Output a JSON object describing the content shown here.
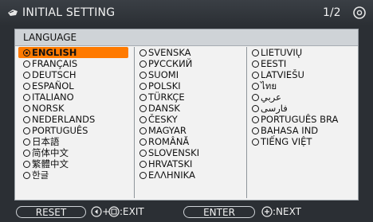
{
  "title_bar": {
    "title": "INITIAL SETTING",
    "page": "1/2"
  },
  "panel": {
    "title": "LANGUAGE",
    "columns": [
      [
        "ENGLISH",
        "FRANÇAIS",
        "DEUTSCH",
        "ESPAÑOL",
        "ITALIANO",
        "NORSK",
        "NEDERLANDS",
        "PORTUGUÊS",
        "日本語",
        "简体中文",
        "繁體中文",
        "한글"
      ],
      [
        "SVENSKA",
        "РУССКИЙ",
        "SUOMI",
        "POLSKI",
        "TÜRKÇE",
        "DANSK",
        "ČESKY",
        "MAGYAR",
        "ROMÂNĂ",
        "SLOVENSKI",
        "HRVATSKI",
        "ΕΛΛΗΝΙΚΑ"
      ],
      [
        "LIETUVIŲ",
        "EESTI",
        "LATVIEŠU",
        "ไทย",
        "عربي",
        "فارسی",
        "PORTUGUÊS BRA",
        "BAHASA IND",
        "TIẾNG VIỆT"
      ]
    ],
    "selected": "ENGLISH"
  },
  "bottom_bar": {
    "reset_label": "RESET",
    "exit_hint": "+",
    "exit_label": ":EXIT",
    "enter_label": "ENTER",
    "next_label": ":NEXT"
  },
  "colors": {
    "selection": "#ff7a00",
    "panel_bg": "#f2f2f2",
    "screen_bg": "#2b2f34"
  }
}
